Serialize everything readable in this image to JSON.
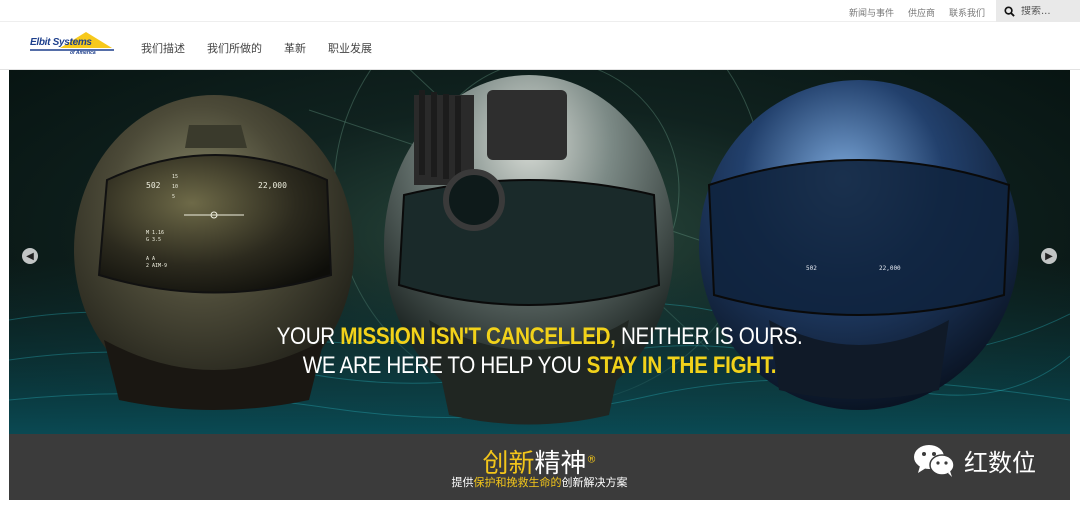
{
  "topbar": {
    "links": [
      "新闻与事件",
      "供应商",
      "联系我们"
    ],
    "search_placeholder": "搜索..."
  },
  "header": {
    "logo_main": "Elbit Systems",
    "logo_sub": "of America",
    "nav": [
      "我们描述",
      "我们所做的",
      "革新",
      "职业发展"
    ]
  },
  "hero": {
    "line1": {
      "pre": "YOUR ",
      "hl": "MISSION ISN'T CANCELLED,",
      "post": " NEITHER IS OURS."
    },
    "line2": {
      "pre": "WE ARE HERE TO HELP YOU ",
      "hl": "STAY IN THE FIGHT."
    },
    "hud_left": [
      "502",
      "15",
      "10",
      "5",
      "22,000",
      "M 1.16",
      "G 3.5",
      "A A",
      "2 AIM-9"
    ],
    "hud_right": [
      "502",
      "22,000"
    ]
  },
  "banner": {
    "title_yellow": "创新",
    "title_white": "精神",
    "reg": "®",
    "sub": {
      "a": "提供",
      "b": "保护和挽救生命的",
      "c": "创新解决方案"
    }
  },
  "watermark": {
    "text": "红数位"
  },
  "colors": {
    "accent_yellow": "#f2d21a",
    "brand_blue": "#1d3f8c",
    "banner_bg": "#3b3b3b"
  }
}
